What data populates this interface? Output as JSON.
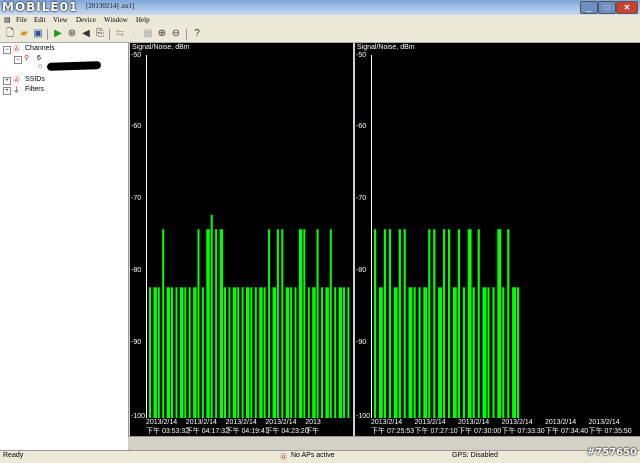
{
  "window": {
    "logo_text": "MOBILE01",
    "title": "[20130214] .ns1]",
    "min_glyph": "_",
    "max_glyph": "□",
    "close_glyph": "✕"
  },
  "menu": [
    "File",
    "Edit",
    "View",
    "Device",
    "Window",
    "Help"
  ],
  "toolbar": {
    "icons": [
      "new-file-icon",
      "open-folder-icon",
      "save-icon",
      "play-icon",
      "scan-icon",
      "audio-icon",
      "export-icon",
      "import-icon",
      "filter-icon",
      "grid-icon",
      "zoom-in-icon",
      "zoom-out-icon",
      "help-icon"
    ]
  },
  "tree": {
    "channels_label": "Channels",
    "channel_number": "6",
    "ssids_label": "SSIDs",
    "filters_label": "Filters"
  },
  "chart_data": [
    {
      "type": "bar",
      "ylabel": "Signal/Noise, dBm",
      "ylim": [
        -100,
        -50
      ],
      "yticks": [
        -50,
        -60,
        -70,
        -80,
        -90,
        -100
      ],
      "xtick_labels": [
        {
          "date": "2013/2/14",
          "time": "下午 03:53:32"
        },
        {
          "date": "2013/2/14",
          "time": "下午 04:17:32"
        },
        {
          "date": "2013/2/14",
          "time": "下午 04:19:41"
        },
        {
          "date": "2013/2/14",
          "time": "下午 04:23:20"
        },
        {
          "date": "2013",
          "time": "下午"
        }
      ],
      "signal_dbm": [
        -82,
        -82,
        -82,
        -74,
        -82,
        -82,
        -82,
        -82,
        -82,
        -82,
        -82,
        -74,
        -82,
        -74,
        -72,
        -74,
        -74,
        -82,
        -82,
        -82,
        -82,
        -82,
        -82,
        -82,
        -82,
        -82,
        -82,
        -74,
        -82,
        -74,
        -74,
        -82,
        -82,
        -82,
        -74,
        -74,
        -82,
        -82,
        -74,
        -82,
        -82,
        -74,
        -82,
        -82,
        -82,
        -82
      ],
      "noise_dbm": -100
    },
    {
      "type": "bar",
      "ylabel": "Signal/Noise, dBm",
      "ylim": [
        -100,
        -50
      ],
      "yticks": [
        -50,
        -60,
        -70,
        -80,
        -90,
        -100
      ],
      "xtick_labels": [
        {
          "date": "2013/2/14",
          "time": "下午 07:25:53"
        },
        {
          "date": "2013/2/14",
          "time": "下午 07:27:10"
        },
        {
          "date": "2013/2/14",
          "time": "下午 07:30:00"
        },
        {
          "date": "2013/2/14",
          "time": "下午 07:33:30"
        },
        {
          "date": "2013/2/14",
          "time": "下午 07:34:40"
        },
        {
          "date": "2013/2/14",
          "time": "下午 07:35:50"
        }
      ],
      "signal_dbm": [
        -74,
        -82,
        -74,
        -74,
        -82,
        -74,
        -74,
        -82,
        -82,
        -82,
        -82,
        -74,
        -74,
        -82,
        -74,
        -74,
        -82,
        -74,
        -82,
        -74,
        -82,
        -74,
        -82,
        -82,
        -82,
        -74,
        -82,
        -74,
        -82,
        -82
      ],
      "noise_dbm": -100
    }
  ],
  "status": {
    "left": "Ready",
    "aps": "No APs active",
    "gps": "GPS: Disabled"
  },
  "watermark": "#757650",
  "colors": {
    "signal": "#00ff00",
    "plot_bg": "#000000"
  }
}
